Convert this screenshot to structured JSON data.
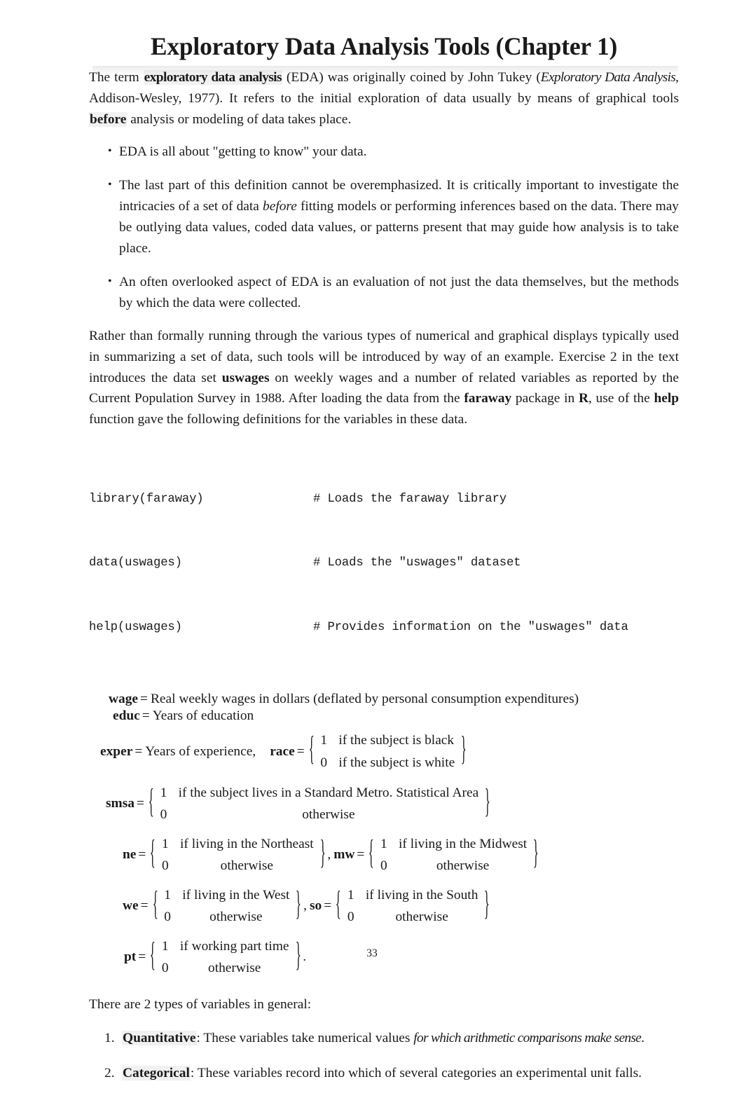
{
  "document": {
    "title": "Exploratory Data Analysis Tools (Chapter 1)",
    "page_number": "33"
  },
  "intro": {
    "p1_a": "The term ",
    "p1_term": "exploratory data analysis",
    "p1_b": " (EDA) was originally coined by John Tukey (",
    "p1_book": "Exploratory Data Analysis",
    "p1_c": ", Addison-Wesley, 1977). It refers to the initial exploration of data usually by means of graphical tools ",
    "p1_before": "before",
    "p1_d": " analysis or modeling of data takes place."
  },
  "bullets": [
    {
      "marker": "•",
      "text": "EDA is all about \"getting to know\" your data."
    },
    {
      "marker": "•",
      "text_a": "The last part of this definition cannot be overemphasized. It is critically important to investigate the intricacies of a set of data ",
      "emph": "before",
      "text_b": " fitting models or performing inferences based on the data. There may be outlying data values, coded data values, or patterns present that may guide how analysis is to take place."
    },
    {
      "marker": "•",
      "text": "An often overlooked aspect of EDA is an evaluation of not just the data themselves, but the methods by which the data were collected."
    }
  ],
  "paragraph2": {
    "a": "Rather than formally running through the various types of numerical and graphical displays typically used in summarizing a set of data, such tools will be introduced by way of an example. Exercise 2 in the text introduces the data set ",
    "dataset": "uswages",
    "b": " on weekly wages and a number of related variables as reported by the Current Population Survey in 1988. After loading the data from the ",
    "package": "faraway",
    "c": " package in ",
    "language": "R",
    "d": ", use of the ",
    "helpfn": "help",
    "e": " function gave the following definitions for the variables in these data."
  },
  "code": [
    {
      "command": "library(faraway)",
      "comment": "# Loads the faraway library"
    },
    {
      "command": "data(uswages)",
      "comment": "# Loads the \"uswages\" dataset"
    },
    {
      "command": "help(uswages)",
      "comment": "# Provides information on the \"uswages\" data"
    }
  ],
  "variables": {
    "wage": {
      "name": "wage",
      "eq": "=",
      "desc": "Real weekly wages in dollars (deflated by personal consumption expenditures)"
    },
    "educ": {
      "name": "educ",
      "eq": "=",
      "desc": "Years of education"
    },
    "exper": {
      "name": "exper",
      "eq": "=",
      "desc": "Years of experience,"
    },
    "race": {
      "name": "race",
      "eq": "=",
      "one_value": "1",
      "one_text": "if the subject is black",
      "zero_value": "0",
      "zero_text": "if the subject is white"
    },
    "smsa": {
      "name": "smsa",
      "eq": "=",
      "one_value": "1",
      "one_text": "if the subject lives in a Standard Metro. Statistical Area",
      "zero_value": "0",
      "zero_text": "otherwise"
    },
    "ne": {
      "name": "ne",
      "eq": "=",
      "one_value": "1",
      "one_text": "if living in the Northeast",
      "zero_value": "0",
      "zero_text": "otherwise"
    },
    "mw": {
      "name": "mw",
      "eq": "=",
      "one_value": "1",
      "one_text": "if living in the Midwest",
      "zero_value": "0",
      "zero_text": "otherwise"
    },
    "we": {
      "name": "we",
      "eq": "=",
      "one_value": "1",
      "one_text": "if living in the West",
      "zero_value": "0",
      "zero_text": "otherwise"
    },
    "so": {
      "name": "so",
      "eq": "=",
      "one_value": "1",
      "one_text": "if living in the South",
      "zero_value": "0",
      "zero_text": "otherwise"
    },
    "pt": {
      "name": "pt",
      "eq": "=",
      "one_value": "1",
      "one_text": "if working part time",
      "zero_value": "0",
      "zero_text": "otherwise"
    },
    "brace_left": "{",
    "brace_right": "}",
    "comma_sep": ",",
    "period": "."
  },
  "types_intro": "There are 2 types of variables in general:",
  "types": [
    {
      "marker": "1.",
      "term": "Quantitative",
      "text_a": ": These variables take numerical values ",
      "emph": "for which arithmetic comparisons make sense",
      "text_b": "."
    },
    {
      "marker": "2.",
      "term": "Categorical",
      "text_a": ": These variables record into which of several categories an experimental unit falls.",
      "emph": "",
      "text_b": ""
    }
  ]
}
